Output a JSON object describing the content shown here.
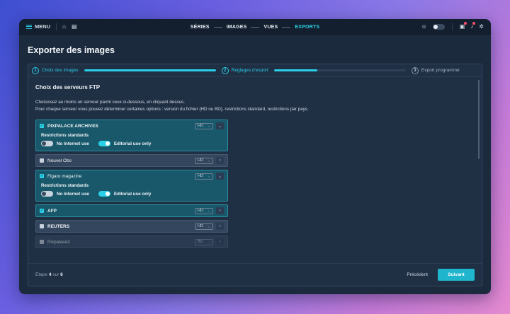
{
  "topbar": {
    "menu_label": "MENU",
    "nav": [
      "SÉRIES",
      "IMAGES",
      "VUES",
      "EXPORTS"
    ],
    "active_nav": "EXPORTS",
    "icons": [
      "home-icon",
      "list-icon",
      "assistant-icon",
      "theme-toggle",
      "cart-icon",
      "bell-icon",
      "gear-icon"
    ]
  },
  "page": {
    "title": "Exporter des images"
  },
  "stepper": {
    "steps": [
      {
        "num": "1",
        "label": "Choix des images",
        "progress": 1.0
      },
      {
        "num": "2",
        "label": "Réglages d'export",
        "progress": 0.33
      },
      {
        "num": "3",
        "label": "Export programmé"
      }
    ]
  },
  "section": {
    "title": "Choix des serveurs FTP",
    "desc1": "Choisissez au moins un serveur parmi ceux ci-dessous, en cliquant dessus.",
    "desc2": "Pour chaque serveur vous pouvez déterminer certaines options : version du fichier (HD ou BD), restrictions standard, restrictions par pays."
  },
  "servers": [
    {
      "name": "PIXPALACE ARCHIVES",
      "checked": true,
      "format": "HD",
      "expanded": true
    },
    {
      "name": "Nouvel Obs",
      "checked": false,
      "format": "HD",
      "expanded": false
    },
    {
      "name": "Figaro magazine",
      "checked": true,
      "format": "HD",
      "expanded": true
    },
    {
      "name": "AFP",
      "checked": true,
      "format": "HD",
      "expanded": false
    },
    {
      "name": "REUTERS",
      "checked": false,
      "format": "HD",
      "expanded": false
    },
    {
      "name": "Pixpalace2",
      "checked": false,
      "format": "BD",
      "expanded": false
    }
  ],
  "restrictions": {
    "title": "Restrictions standards",
    "no_internet": "No Internet use",
    "editorial": "Editorial use only"
  },
  "footer": {
    "step_prefix": "Étape",
    "step_current": "4",
    "step_sep": "sur",
    "step_total": "6",
    "prev_label": "Précédent",
    "next_label": "Suivant"
  },
  "colors": {
    "accent": "#2ad0e8",
    "window_bg": "#1c2a3d",
    "button": "#1fb5cc"
  }
}
